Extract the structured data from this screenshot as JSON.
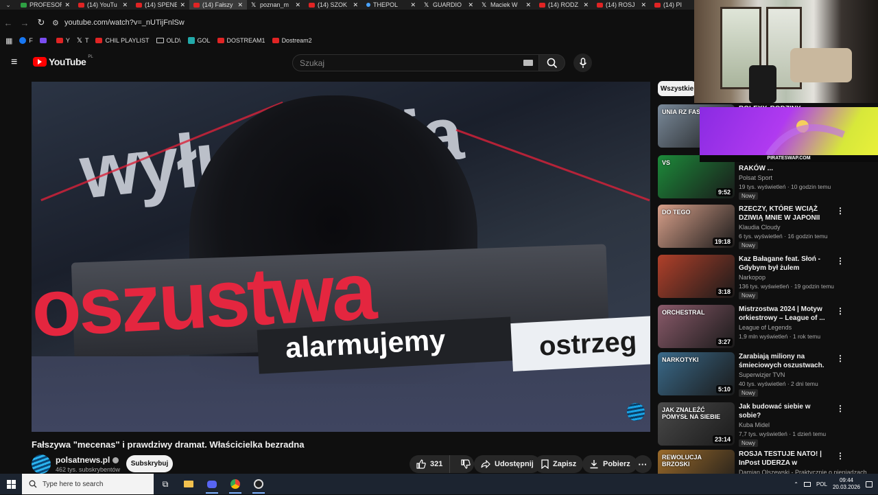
{
  "browser": {
    "tabs": [
      {
        "label": "PROFESOR",
        "icon": "green",
        "active": false
      },
      {
        "label": "(14) YouTu",
        "icon": "youtube",
        "active": false
      },
      {
        "label": "(14) SPENE",
        "icon": "youtube",
        "active": false
      },
      {
        "label": "(14) Fałszy",
        "icon": "youtube",
        "active": true
      },
      {
        "label": "poznan_m",
        "icon": "x",
        "active": false
      },
      {
        "label": "(14) SZOK",
        "icon": "youtube",
        "active": false
      },
      {
        "label": "THEPOL",
        "icon": "dot",
        "active": false
      },
      {
        "label": "GUARDIO",
        "icon": "x",
        "active": false
      },
      {
        "label": "Maciek W",
        "icon": "x",
        "active": false
      },
      {
        "label": "(14) RODZ",
        "icon": "youtube",
        "active": false
      },
      {
        "label": "(14) ROSJ",
        "icon": "youtube",
        "active": false
      },
      {
        "label": "(14) PI",
        "icon": "youtube",
        "active": false
      }
    ],
    "url": "youtube.com/watch?v=_nUTijFnlSw",
    "bookmarks": [
      {
        "label": "F",
        "icon": "fb"
      },
      {
        "label": "",
        "icon": "twitch"
      },
      {
        "label": "Y",
        "icon": "youtube"
      },
      {
        "label": "T",
        "icon": "x"
      },
      {
        "label": "CHIL PLAYLIST",
        "icon": "youtube"
      },
      {
        "label": "OLD\\",
        "icon": "folder"
      },
      {
        "label": "GOL",
        "icon": "g"
      },
      {
        "label": "DOSTREAM1",
        "icon": "youtube"
      },
      {
        "label": "Dostream2",
        "icon": "youtube"
      }
    ]
  },
  "youtube": {
    "logo_text": "YouTube",
    "logo_country": "PL",
    "search_placeholder": "Szukaj"
  },
  "video": {
    "overlay_bg_text": "wyłudzenia",
    "overlay_main": "oszustwa",
    "overlay_sub1": "alarmujemy",
    "overlay_sub2": "ostrzeg",
    "title": "Fałszywa \"mecenas\" i prawdziwy dramat. Właścicielka bezradna",
    "channel": "polsatnews.pl",
    "subscribers": "462 tys. subskrybentów",
    "subscribe_label": "Subskrybuj",
    "likes": "321",
    "share_label": "Udostępnij",
    "save_label": "Zapisz",
    "download_label": "Pobierz"
  },
  "sidebar": {
    "chip": "Wszystkie",
    "items": [
      {
        "title": "ROLEXY, RODZINY, POŁOWA...",
        "channel": "",
        "views": "",
        "new": "",
        "duration": "",
        "thumb": "#7a8a9a",
        "thumb_text": "UNIA RZ FASZ"
      },
      {
        "title": "MARZENIA! SKRÓT: RAKÓW ...",
        "channel": "Polsat Sport",
        "views": "19 tys. wyświetleń · 10 godzin temu",
        "new": "Nowy",
        "duration": "9:52",
        "thumb": "#1c8a3a",
        "thumb_text": "VS"
      },
      {
        "title": "RZECZY, KTÓRE WCIĄŻ DZIWIĄ MNIE W JAPONII",
        "channel": "Klaudia Cloudy",
        "views": "6 tys. wyświetleń · 16 godzin temu",
        "new": "Nowy",
        "duration": "19:18",
        "thumb": "#d8a08a",
        "thumb_text": "DO TEGO"
      },
      {
        "title": "Kaz Bałagane feat. Słoń - Gdybym był żulem",
        "channel": "Narkopop",
        "views": "136 tys. wyświetleń · 19 godzin temu",
        "new": "Nowy",
        "duration": "3:18",
        "thumb": "#b0402a",
        "thumb_text": ""
      },
      {
        "title": "Mistrzostwa 2024 | Motyw orkiestrowy – League of ...",
        "channel": "League of Legends",
        "views": "1,9 mln wyświetleń · 1 rok temu",
        "new": "",
        "duration": "3:27",
        "thumb": "#8a5a6a",
        "thumb_text": "ORCHESTRAL"
      },
      {
        "title": "Zarabiają miliony na śmieciowych oszustwach. Skr...",
        "channel": "Superwizjer TVN",
        "views": "40 tys. wyświetleń · 2 dni temu",
        "new": "Nowy",
        "duration": "5:10",
        "thumb": "#3a6a8a",
        "thumb_text": "NARKOTYKI"
      },
      {
        "title": "Jak budować siebie w sobie?",
        "channel": "Kuba Midel",
        "views": "7,7 tys. wyświetleń · 1 dzień temu",
        "new": "Nowy",
        "duration": "23:14",
        "thumb": "#4a4a4a",
        "thumb_text": "JAK ZNALEŹĆ POMYSŁ NA SIEBIE"
      },
      {
        "title": "ROSJA TESTUJE NATO! | InPost UDERZA w ALLEGRO, a BAŁTY...",
        "channel": "Damian Olszewski - Praktycznie o pieniądzach",
        "views": "",
        "new": "",
        "duration": "",
        "thumb": "#9a6a2a",
        "thumb_text": "REWOLUCJA BRZOSKI"
      }
    ]
  },
  "overlay": {
    "banner_text": "PIRATESWAP.COM"
  },
  "taskbar": {
    "search_placeholder": "Type here to search",
    "lang": "POL",
    "time": "09:44",
    "date": "20.03.2026"
  }
}
